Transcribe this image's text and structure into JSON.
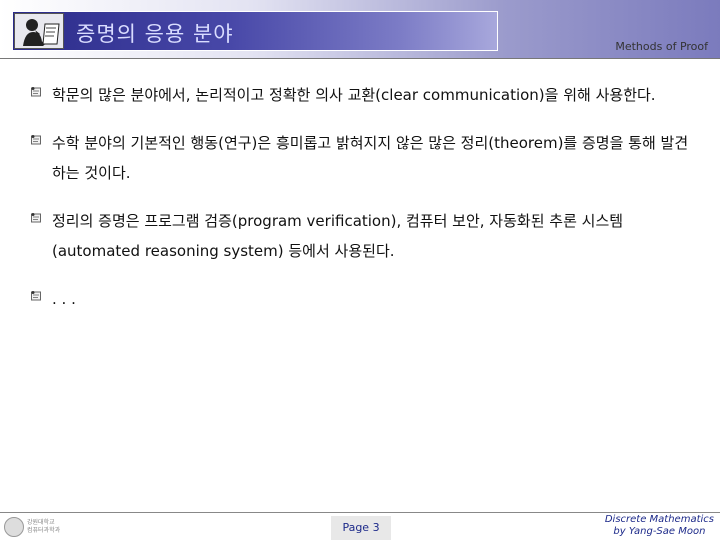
{
  "header": {
    "title": "증명의 응용 분야",
    "right_label": "Methods of Proof"
  },
  "bullets": [
    {
      "text": "학문의 많은 분야에서, 논리적이고 정확한 의사 교환(clear communication)을 위해 사용한다."
    },
    {
      "text": "수학 분야의 기본적인 행동(연구)은 흥미롭고 밝혀지지 않은 많은 정리(theorem)를 증명을 통해 발견하는 것이다."
    },
    {
      "text": "정리의 증명은 프로그램 검증(program verification), 컴퓨터 보안, 자동화된 추론 시스템(automated reasoning system) 등에서 사용된다."
    },
    {
      "text": ". . ."
    }
  ],
  "footer": {
    "page": "Page 3",
    "course_line1": "Discrete Mathematics",
    "course_line2": "by Yang-Sae Moon",
    "logo_line1": "강원대학교",
    "logo_line2": "컴퓨터과학과"
  },
  "colors": {
    "title_text": "#d9dcff",
    "footer_text": "#1d2a8a",
    "title_box": "#2b2b8a"
  }
}
